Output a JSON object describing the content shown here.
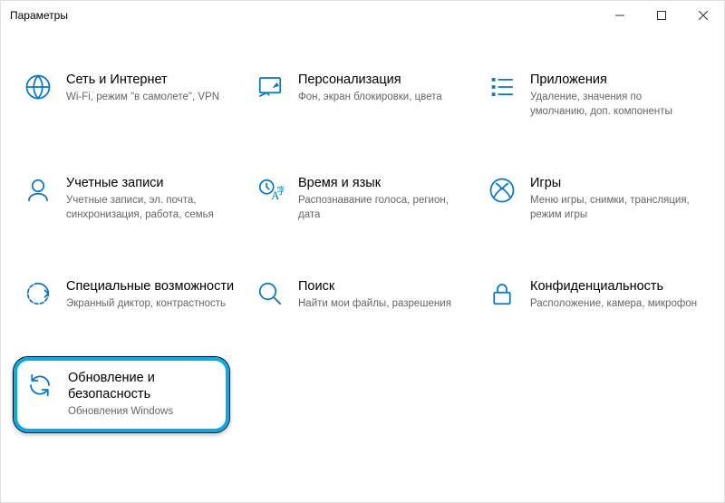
{
  "window": {
    "title": "Параметры"
  },
  "tiles": {
    "network": {
      "title": "Сеть и Интернет",
      "desc": "Wi-Fi, режим \"в самолете\", VPN"
    },
    "personalize": {
      "title": "Персонализация",
      "desc": "Фон, экран блокировки, цвета"
    },
    "apps": {
      "title": "Приложения",
      "desc": "Удаление, значения по умолчанию, доп. компоненты"
    },
    "accounts": {
      "title": "Учетные записи",
      "desc": "Учетные записи, эл. почта, синхронизация, работа, семья"
    },
    "time": {
      "title": "Время и язык",
      "desc": "Распознавание голоса, регион, дата"
    },
    "gaming": {
      "title": "Игры",
      "desc": "Меню игры, снимки, трансляция, режим игры"
    },
    "ease": {
      "title": "Специальные возможности",
      "desc": "Экранный диктор, контрастность"
    },
    "search": {
      "title": "Поиск",
      "desc": "Найти мои файлы, разрешения"
    },
    "privacy": {
      "title": "Конфиденциальность",
      "desc": "Расположение, камера, микрофон"
    },
    "update": {
      "title": "Обновление и безопасность",
      "desc": "Обновления Windows"
    }
  }
}
